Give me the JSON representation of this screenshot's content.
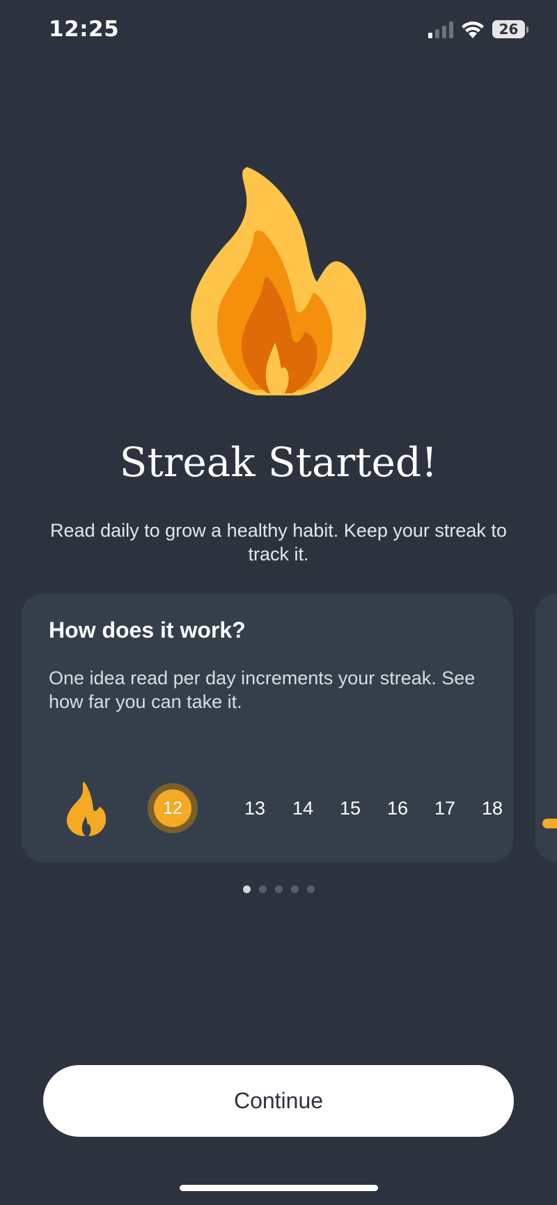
{
  "status_bar": {
    "time": "12:25",
    "battery_level": "26",
    "signal_icon": "cellular-signal-icon",
    "wifi_icon": "wifi-icon",
    "battery_icon": "battery-icon"
  },
  "hero": {
    "icon": "flame-icon",
    "title": "Streak Started!",
    "subtitle": "Read daily to grow a healthy habit. Keep your streak to track it."
  },
  "card": {
    "title": "How does it work?",
    "text": "One idea read per day increments your streak. See how far you can take it.",
    "streak_icon": "flame-icon",
    "current_day": "12",
    "days": [
      "13",
      "14",
      "15",
      "16",
      "17",
      "18"
    ]
  },
  "pager": {
    "total": 5,
    "active_index": 0
  },
  "actions": {
    "continue_label": "Continue"
  },
  "colors": {
    "background": "#2d333e",
    "card": "#353f4b",
    "accent": "#f5aa24",
    "flame_outer": "#ffc54a",
    "flame_mid": "#f4900c",
    "flame_inner": "#de6b08"
  }
}
